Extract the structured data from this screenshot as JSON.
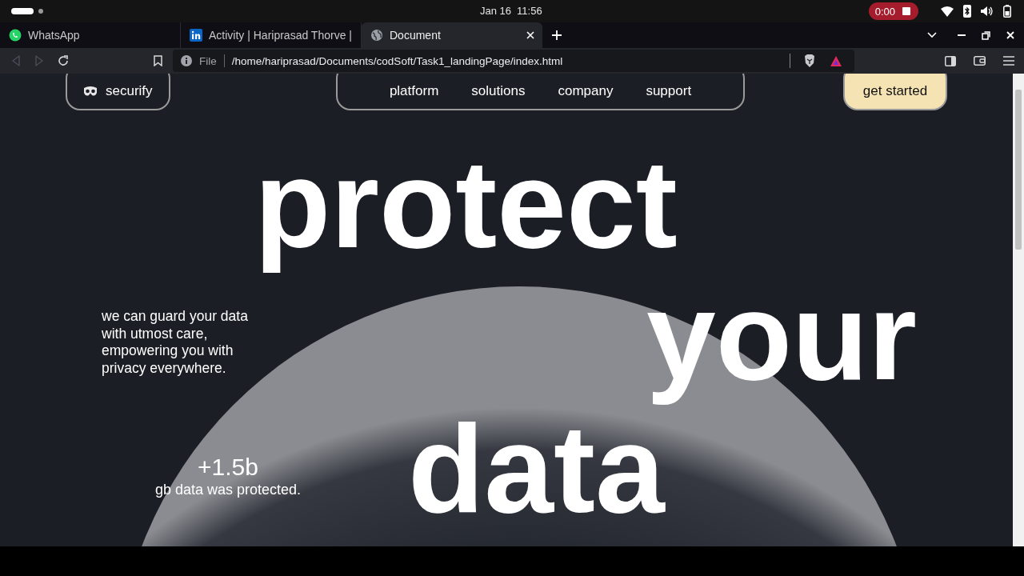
{
  "system_bar": {
    "date": "Jan 16",
    "time": "11:56",
    "recording": "0:00"
  },
  "tabs": [
    {
      "title": "WhatsApp",
      "kind": "whatsapp",
      "selected": false
    },
    {
      "title": "Activity | Hariprasad Thorve |",
      "kind": "linkedin",
      "selected": false
    },
    {
      "title": "Document",
      "kind": "globe",
      "selected": true
    }
  ],
  "nav_buttons": [
    {
      "kind": "back",
      "disabled": true
    },
    {
      "kind": "forward",
      "disabled": true
    },
    {
      "kind": "reload",
      "disabled": false
    }
  ],
  "address_bar": {
    "scheme": "File",
    "url": "/home/hariprasad/Documents/codSoft/Task1_landingPage/index.html"
  },
  "page": {
    "brand": "securify",
    "nav": [
      "platform",
      "solutions",
      "company",
      "support"
    ],
    "cta": "get started",
    "headline": [
      "protect",
      "your",
      "data"
    ],
    "tagline": "we can guard your data with utmost care, empowering you with privacy everywhere.",
    "stat": {
      "value": "+1.5b",
      "caption": "gb data was protected."
    }
  }
}
